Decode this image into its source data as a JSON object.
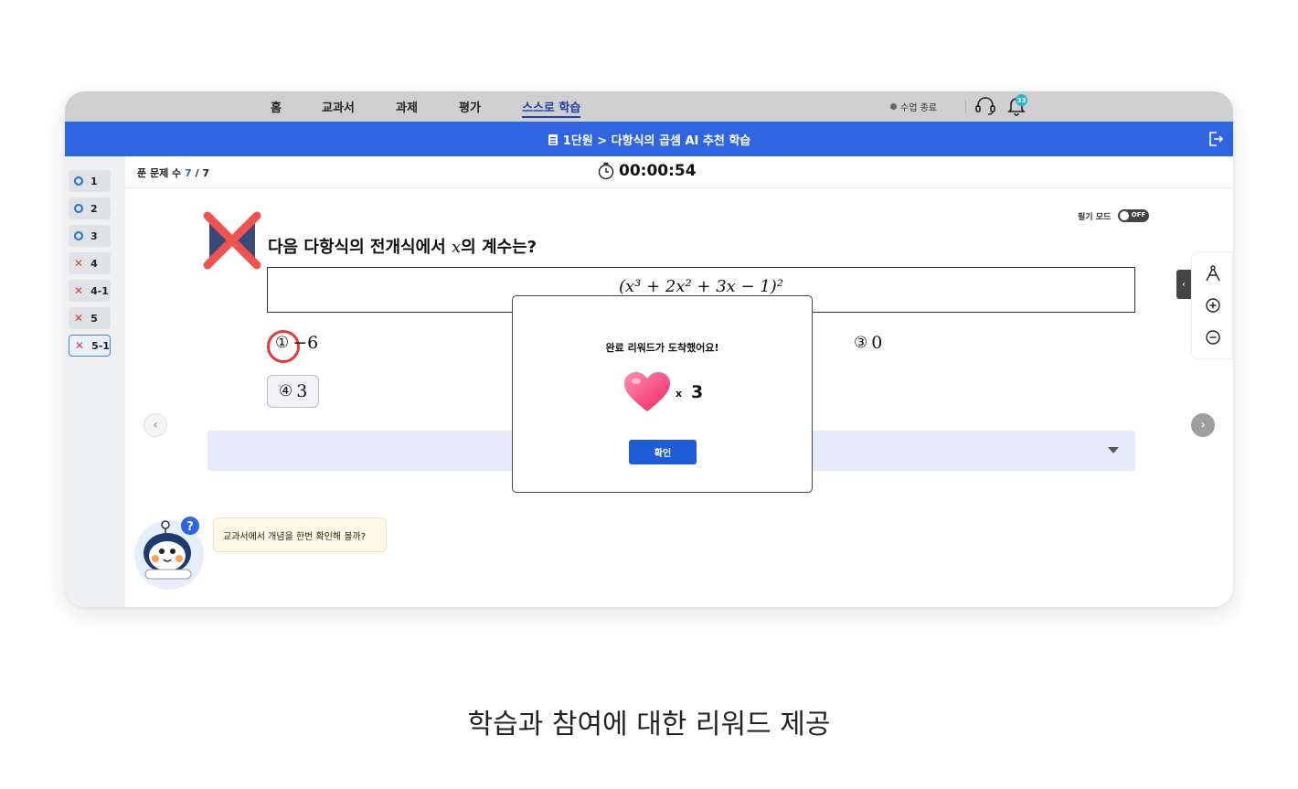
{
  "nav": {
    "items": [
      "홈",
      "교과서",
      "과제",
      "평가",
      "스스로 학습"
    ],
    "active_index": 4,
    "end_class": "수업 종료",
    "notification_count": "33"
  },
  "header": {
    "breadcrumb": "1단원 > 다항식의 곱셈 AI 추천 학습"
  },
  "sidebar": {
    "items": [
      {
        "label": "1",
        "result": "correct"
      },
      {
        "label": "2",
        "result": "correct"
      },
      {
        "label": "3",
        "result": "correct"
      },
      {
        "label": "4",
        "result": "wrong"
      },
      {
        "label": "4-1",
        "result": "wrong"
      },
      {
        "label": "5",
        "result": "wrong"
      },
      {
        "label": "5-1",
        "result": "wrong",
        "selected": true
      }
    ]
  },
  "status": {
    "solved_label": "푼 문제 수",
    "solved_count": "7",
    "solved_total": "/ 7",
    "timer": "00:00:54"
  },
  "writing_mode": {
    "label": "필기 모드",
    "state": "OFF"
  },
  "question": {
    "text_before": "다음 다항식의 전개식에서",
    "variable": "x",
    "text_after": "의 계수는?",
    "formula": "(x³ + 2x² + 3x − 1)²",
    "choices": [
      {
        "mark": "①",
        "value": "−6"
      },
      {
        "mark": "③",
        "value": "0"
      },
      {
        "mark": "④",
        "value": "3"
      }
    ]
  },
  "hint": {
    "bubble": "교과서에서 개념을 한번 확인해 볼까?"
  },
  "modal": {
    "title": "완료 리워드가 도착했어요!",
    "times": "x",
    "count": "3",
    "confirm": "확인"
  },
  "caption": "학습과 참여에 대한 리워드 제공",
  "colors": {
    "brand_blue": "#2f65e0",
    "correct": "#1e6fe0",
    "wrong": "#e53935"
  }
}
